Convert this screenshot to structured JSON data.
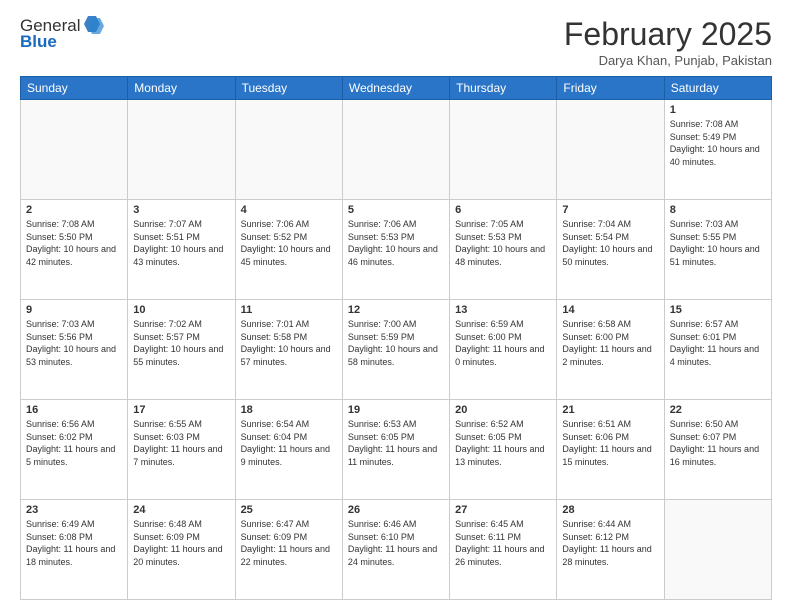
{
  "header": {
    "logo_line1": "General",
    "logo_line2": "Blue",
    "month": "February 2025",
    "location": "Darya Khan, Punjab, Pakistan"
  },
  "weekdays": [
    "Sunday",
    "Monday",
    "Tuesday",
    "Wednesday",
    "Thursday",
    "Friday",
    "Saturday"
  ],
  "weeks": [
    [
      {
        "day": "",
        "info": ""
      },
      {
        "day": "",
        "info": ""
      },
      {
        "day": "",
        "info": ""
      },
      {
        "day": "",
        "info": ""
      },
      {
        "day": "",
        "info": ""
      },
      {
        "day": "",
        "info": ""
      },
      {
        "day": "1",
        "info": "Sunrise: 7:08 AM\nSunset: 5:49 PM\nDaylight: 10 hours and 40 minutes."
      }
    ],
    [
      {
        "day": "2",
        "info": "Sunrise: 7:08 AM\nSunset: 5:50 PM\nDaylight: 10 hours and 42 minutes."
      },
      {
        "day": "3",
        "info": "Sunrise: 7:07 AM\nSunset: 5:51 PM\nDaylight: 10 hours and 43 minutes."
      },
      {
        "day": "4",
        "info": "Sunrise: 7:06 AM\nSunset: 5:52 PM\nDaylight: 10 hours and 45 minutes."
      },
      {
        "day": "5",
        "info": "Sunrise: 7:06 AM\nSunset: 5:53 PM\nDaylight: 10 hours and 46 minutes."
      },
      {
        "day": "6",
        "info": "Sunrise: 7:05 AM\nSunset: 5:53 PM\nDaylight: 10 hours and 48 minutes."
      },
      {
        "day": "7",
        "info": "Sunrise: 7:04 AM\nSunset: 5:54 PM\nDaylight: 10 hours and 50 minutes."
      },
      {
        "day": "8",
        "info": "Sunrise: 7:03 AM\nSunset: 5:55 PM\nDaylight: 10 hours and 51 minutes."
      }
    ],
    [
      {
        "day": "9",
        "info": "Sunrise: 7:03 AM\nSunset: 5:56 PM\nDaylight: 10 hours and 53 minutes."
      },
      {
        "day": "10",
        "info": "Sunrise: 7:02 AM\nSunset: 5:57 PM\nDaylight: 10 hours and 55 minutes."
      },
      {
        "day": "11",
        "info": "Sunrise: 7:01 AM\nSunset: 5:58 PM\nDaylight: 10 hours and 57 minutes."
      },
      {
        "day": "12",
        "info": "Sunrise: 7:00 AM\nSunset: 5:59 PM\nDaylight: 10 hours and 58 minutes."
      },
      {
        "day": "13",
        "info": "Sunrise: 6:59 AM\nSunset: 6:00 PM\nDaylight: 11 hours and 0 minutes."
      },
      {
        "day": "14",
        "info": "Sunrise: 6:58 AM\nSunset: 6:00 PM\nDaylight: 11 hours and 2 minutes."
      },
      {
        "day": "15",
        "info": "Sunrise: 6:57 AM\nSunset: 6:01 PM\nDaylight: 11 hours and 4 minutes."
      }
    ],
    [
      {
        "day": "16",
        "info": "Sunrise: 6:56 AM\nSunset: 6:02 PM\nDaylight: 11 hours and 5 minutes."
      },
      {
        "day": "17",
        "info": "Sunrise: 6:55 AM\nSunset: 6:03 PM\nDaylight: 11 hours and 7 minutes."
      },
      {
        "day": "18",
        "info": "Sunrise: 6:54 AM\nSunset: 6:04 PM\nDaylight: 11 hours and 9 minutes."
      },
      {
        "day": "19",
        "info": "Sunrise: 6:53 AM\nSunset: 6:05 PM\nDaylight: 11 hours and 11 minutes."
      },
      {
        "day": "20",
        "info": "Sunrise: 6:52 AM\nSunset: 6:05 PM\nDaylight: 11 hours and 13 minutes."
      },
      {
        "day": "21",
        "info": "Sunrise: 6:51 AM\nSunset: 6:06 PM\nDaylight: 11 hours and 15 minutes."
      },
      {
        "day": "22",
        "info": "Sunrise: 6:50 AM\nSunset: 6:07 PM\nDaylight: 11 hours and 16 minutes."
      }
    ],
    [
      {
        "day": "23",
        "info": "Sunrise: 6:49 AM\nSunset: 6:08 PM\nDaylight: 11 hours and 18 minutes."
      },
      {
        "day": "24",
        "info": "Sunrise: 6:48 AM\nSunset: 6:09 PM\nDaylight: 11 hours and 20 minutes."
      },
      {
        "day": "25",
        "info": "Sunrise: 6:47 AM\nSunset: 6:09 PM\nDaylight: 11 hours and 22 minutes."
      },
      {
        "day": "26",
        "info": "Sunrise: 6:46 AM\nSunset: 6:10 PM\nDaylight: 11 hours and 24 minutes."
      },
      {
        "day": "27",
        "info": "Sunrise: 6:45 AM\nSunset: 6:11 PM\nDaylight: 11 hours and 26 minutes."
      },
      {
        "day": "28",
        "info": "Sunrise: 6:44 AM\nSunset: 6:12 PM\nDaylight: 11 hours and 28 minutes."
      },
      {
        "day": "",
        "info": ""
      }
    ]
  ]
}
